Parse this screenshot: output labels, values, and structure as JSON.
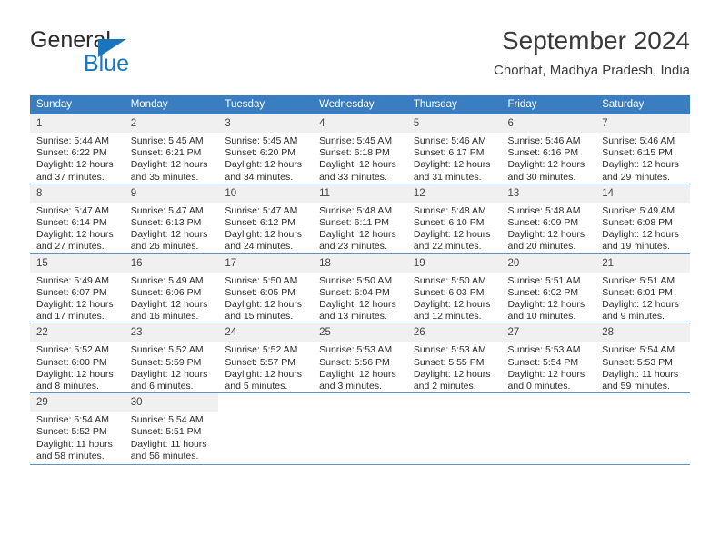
{
  "brand": {
    "name_dark": "General",
    "name_blue": "Blue",
    "flag_icon": "triangle-flag-icon",
    "accent_color": "#1b75bb"
  },
  "header": {
    "title": "September 2024",
    "subtitle": "Chorhat, Madhya Pradesh, India"
  },
  "theme": {
    "header_row_bg": "#3a7dc0",
    "daynum_bg": "#f0f0f0",
    "grid_line": "#5b93c9"
  },
  "weekdays": [
    "Sunday",
    "Monday",
    "Tuesday",
    "Wednesday",
    "Thursday",
    "Friday",
    "Saturday"
  ],
  "weeks": [
    [
      {
        "day": "1",
        "sunrise": "Sunrise: 5:44 AM",
        "sunset": "Sunset: 6:22 PM",
        "daylight1": "Daylight: 12 hours",
        "daylight2": "and 37 minutes."
      },
      {
        "day": "2",
        "sunrise": "Sunrise: 5:45 AM",
        "sunset": "Sunset: 6:21 PM",
        "daylight1": "Daylight: 12 hours",
        "daylight2": "and 35 minutes."
      },
      {
        "day": "3",
        "sunrise": "Sunrise: 5:45 AM",
        "sunset": "Sunset: 6:20 PM",
        "daylight1": "Daylight: 12 hours",
        "daylight2": "and 34 minutes."
      },
      {
        "day": "4",
        "sunrise": "Sunrise: 5:45 AM",
        "sunset": "Sunset: 6:18 PM",
        "daylight1": "Daylight: 12 hours",
        "daylight2": "and 33 minutes."
      },
      {
        "day": "5",
        "sunrise": "Sunrise: 5:46 AM",
        "sunset": "Sunset: 6:17 PM",
        "daylight1": "Daylight: 12 hours",
        "daylight2": "and 31 minutes."
      },
      {
        "day": "6",
        "sunrise": "Sunrise: 5:46 AM",
        "sunset": "Sunset: 6:16 PM",
        "daylight1": "Daylight: 12 hours",
        "daylight2": "and 30 minutes."
      },
      {
        "day": "7",
        "sunrise": "Sunrise: 5:46 AM",
        "sunset": "Sunset: 6:15 PM",
        "daylight1": "Daylight: 12 hours",
        "daylight2": "and 29 minutes."
      }
    ],
    [
      {
        "day": "8",
        "sunrise": "Sunrise: 5:47 AM",
        "sunset": "Sunset: 6:14 PM",
        "daylight1": "Daylight: 12 hours",
        "daylight2": "and 27 minutes."
      },
      {
        "day": "9",
        "sunrise": "Sunrise: 5:47 AM",
        "sunset": "Sunset: 6:13 PM",
        "daylight1": "Daylight: 12 hours",
        "daylight2": "and 26 minutes."
      },
      {
        "day": "10",
        "sunrise": "Sunrise: 5:47 AM",
        "sunset": "Sunset: 6:12 PM",
        "daylight1": "Daylight: 12 hours",
        "daylight2": "and 24 minutes."
      },
      {
        "day": "11",
        "sunrise": "Sunrise: 5:48 AM",
        "sunset": "Sunset: 6:11 PM",
        "daylight1": "Daylight: 12 hours",
        "daylight2": "and 23 minutes."
      },
      {
        "day": "12",
        "sunrise": "Sunrise: 5:48 AM",
        "sunset": "Sunset: 6:10 PM",
        "daylight1": "Daylight: 12 hours",
        "daylight2": "and 22 minutes."
      },
      {
        "day": "13",
        "sunrise": "Sunrise: 5:48 AM",
        "sunset": "Sunset: 6:09 PM",
        "daylight1": "Daylight: 12 hours",
        "daylight2": "and 20 minutes."
      },
      {
        "day": "14",
        "sunrise": "Sunrise: 5:49 AM",
        "sunset": "Sunset: 6:08 PM",
        "daylight1": "Daylight: 12 hours",
        "daylight2": "and 19 minutes."
      }
    ],
    [
      {
        "day": "15",
        "sunrise": "Sunrise: 5:49 AM",
        "sunset": "Sunset: 6:07 PM",
        "daylight1": "Daylight: 12 hours",
        "daylight2": "and 17 minutes."
      },
      {
        "day": "16",
        "sunrise": "Sunrise: 5:49 AM",
        "sunset": "Sunset: 6:06 PM",
        "daylight1": "Daylight: 12 hours",
        "daylight2": "and 16 minutes."
      },
      {
        "day": "17",
        "sunrise": "Sunrise: 5:50 AM",
        "sunset": "Sunset: 6:05 PM",
        "daylight1": "Daylight: 12 hours",
        "daylight2": "and 15 minutes."
      },
      {
        "day": "18",
        "sunrise": "Sunrise: 5:50 AM",
        "sunset": "Sunset: 6:04 PM",
        "daylight1": "Daylight: 12 hours",
        "daylight2": "and 13 minutes."
      },
      {
        "day": "19",
        "sunrise": "Sunrise: 5:50 AM",
        "sunset": "Sunset: 6:03 PM",
        "daylight1": "Daylight: 12 hours",
        "daylight2": "and 12 minutes."
      },
      {
        "day": "20",
        "sunrise": "Sunrise: 5:51 AM",
        "sunset": "Sunset: 6:02 PM",
        "daylight1": "Daylight: 12 hours",
        "daylight2": "and 10 minutes."
      },
      {
        "day": "21",
        "sunrise": "Sunrise: 5:51 AM",
        "sunset": "Sunset: 6:01 PM",
        "daylight1": "Daylight: 12 hours",
        "daylight2": "and 9 minutes."
      }
    ],
    [
      {
        "day": "22",
        "sunrise": "Sunrise: 5:52 AM",
        "sunset": "Sunset: 6:00 PM",
        "daylight1": "Daylight: 12 hours",
        "daylight2": "and 8 minutes."
      },
      {
        "day": "23",
        "sunrise": "Sunrise: 5:52 AM",
        "sunset": "Sunset: 5:59 PM",
        "daylight1": "Daylight: 12 hours",
        "daylight2": "and 6 minutes."
      },
      {
        "day": "24",
        "sunrise": "Sunrise: 5:52 AM",
        "sunset": "Sunset: 5:57 PM",
        "daylight1": "Daylight: 12 hours",
        "daylight2": "and 5 minutes."
      },
      {
        "day": "25",
        "sunrise": "Sunrise: 5:53 AM",
        "sunset": "Sunset: 5:56 PM",
        "daylight1": "Daylight: 12 hours",
        "daylight2": "and 3 minutes."
      },
      {
        "day": "26",
        "sunrise": "Sunrise: 5:53 AM",
        "sunset": "Sunset: 5:55 PM",
        "daylight1": "Daylight: 12 hours",
        "daylight2": "and 2 minutes."
      },
      {
        "day": "27",
        "sunrise": "Sunrise: 5:53 AM",
        "sunset": "Sunset: 5:54 PM",
        "daylight1": "Daylight: 12 hours",
        "daylight2": "and 0 minutes."
      },
      {
        "day": "28",
        "sunrise": "Sunrise: 5:54 AM",
        "sunset": "Sunset: 5:53 PM",
        "daylight1": "Daylight: 11 hours",
        "daylight2": "and 59 minutes."
      }
    ],
    [
      {
        "day": "29",
        "sunrise": "Sunrise: 5:54 AM",
        "sunset": "Sunset: 5:52 PM",
        "daylight1": "Daylight: 11 hours",
        "daylight2": "and 58 minutes."
      },
      {
        "day": "30",
        "sunrise": "Sunrise: 5:54 AM",
        "sunset": "Sunset: 5:51 PM",
        "daylight1": "Daylight: 11 hours",
        "daylight2": "and 56 minutes."
      },
      {
        "day": "",
        "sunrise": "",
        "sunset": "",
        "daylight1": "",
        "daylight2": ""
      },
      {
        "day": "",
        "sunrise": "",
        "sunset": "",
        "daylight1": "",
        "daylight2": ""
      },
      {
        "day": "",
        "sunrise": "",
        "sunset": "",
        "daylight1": "",
        "daylight2": ""
      },
      {
        "day": "",
        "sunrise": "",
        "sunset": "",
        "daylight1": "",
        "daylight2": ""
      },
      {
        "day": "",
        "sunrise": "",
        "sunset": "",
        "daylight1": "",
        "daylight2": ""
      }
    ]
  ]
}
